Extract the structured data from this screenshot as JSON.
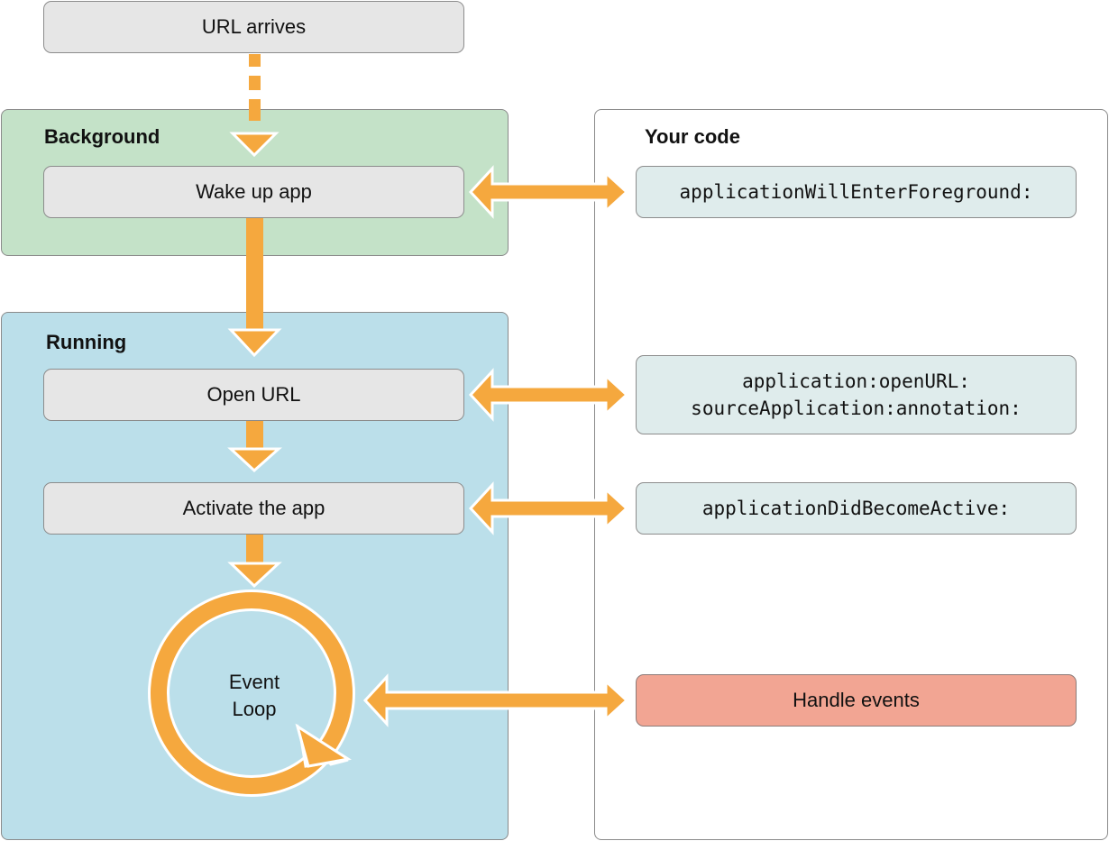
{
  "diagram": {
    "trigger": {
      "label": "URL arrives"
    },
    "background": {
      "title": "Background",
      "steps": [
        {
          "label": "Wake up app"
        }
      ]
    },
    "running": {
      "title": "Running",
      "steps": [
        {
          "label": "Open URL"
        },
        {
          "label": "Activate the app"
        }
      ],
      "event_loop": {
        "line1": "Event",
        "line2": "Loop"
      }
    },
    "your_code": {
      "title": "Your code",
      "callbacks": [
        {
          "lines": [
            "applicationWillEnterForeground:"
          ]
        },
        {
          "lines": [
            "application:openURL:",
            "sourceApplication:annotation:"
          ]
        },
        {
          "lines": [
            "applicationDidBecomeActive:"
          ]
        }
      ],
      "handler": {
        "label": "Handle events"
      }
    },
    "colors": {
      "arrow": "#f5a83e",
      "background_region": "#c4e2c8",
      "running_region": "#bbdfea",
      "step_box": "#e6e6e6",
      "code_box": "#dfecec",
      "handler_box": "#f2a593"
    }
  }
}
